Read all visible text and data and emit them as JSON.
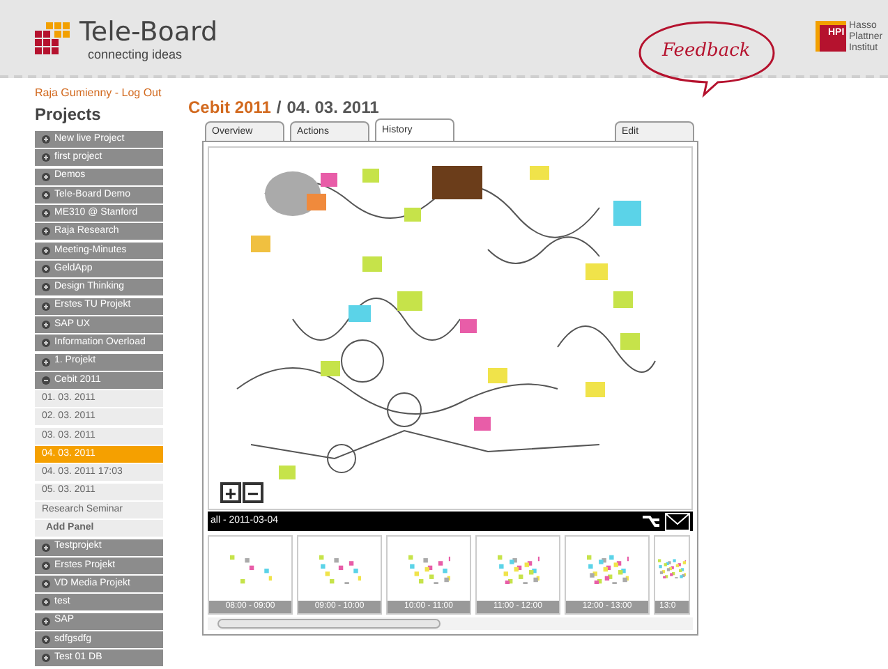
{
  "header": {
    "logo_title": "Tele-Board",
    "logo_tagline": "connecting ideas",
    "feedback": "Feedback",
    "institute_badge": "HPI",
    "institute_name": [
      "Hasso",
      "Plattner",
      "Institut"
    ]
  },
  "user_link": "Raja Gumienny - Log Out",
  "sidebar": {
    "title": "Projects",
    "items": [
      {
        "label": "New live Project",
        "expanded": false
      },
      {
        "label": "first project",
        "expanded": false
      },
      {
        "label": "Demos",
        "expanded": false
      },
      {
        "label": "Tele-Board Demo",
        "expanded": false
      },
      {
        "label": "ME310 @ Stanford",
        "expanded": false
      },
      {
        "label": "Raja Research",
        "expanded": false
      },
      {
        "label": "Meeting-Minutes",
        "expanded": false
      },
      {
        "label": "GeldApp",
        "expanded": false
      },
      {
        "label": "Design Thinking",
        "expanded": false
      },
      {
        "label": "Erstes TU Projekt",
        "expanded": false
      },
      {
        "label": "SAP UX",
        "expanded": false
      },
      {
        "label": "Information Overload",
        "expanded": false
      },
      {
        "label": "1. Projekt",
        "expanded": false
      },
      {
        "label": "Cebit 2011",
        "expanded": true,
        "children": [
          {
            "label": "01. 03. 2011",
            "kind": "panel",
            "selected": false
          },
          {
            "label": "02. 03. 2011",
            "kind": "panel",
            "selected": false
          },
          {
            "label": "03. 03. 2011",
            "kind": "panel",
            "selected": false
          },
          {
            "label": "04. 03. 2011",
            "kind": "panel",
            "selected": true
          },
          {
            "label": "04. 03. 2011 17:03",
            "kind": "panel",
            "selected": false
          },
          {
            "label": "05. 03. 2011",
            "kind": "panel",
            "selected": false
          },
          {
            "label": "Research Seminar",
            "kind": "panel",
            "selected": false
          },
          {
            "label": "Add Panel",
            "kind": "action",
            "selected": false
          }
        ]
      },
      {
        "label": "Testprojekt",
        "expanded": false
      },
      {
        "label": "Erstes Projekt",
        "expanded": false
      },
      {
        "label": "VD Media Projekt",
        "expanded": false
      },
      {
        "label": "test",
        "expanded": false
      },
      {
        "label": "SAP",
        "expanded": false
      },
      {
        "label": "sdfgsdfg",
        "expanded": false
      },
      {
        "label": "Test 01 DB",
        "expanded": false
      }
    ]
  },
  "breadcrumb": {
    "project": "Cebit 2011",
    "separator": "/",
    "panel": "04. 03. 2011"
  },
  "tabs": [
    {
      "label": "Overview",
      "selected": false
    },
    {
      "label": "Actions",
      "selected": false
    },
    {
      "label": "History",
      "selected": true
    },
    {
      "label": "Edit",
      "selected": false
    }
  ],
  "zoom_controls": [
    "+",
    "−"
  ],
  "timeline": {
    "label": "all - 2011-03-04",
    "snapshots": [
      {
        "caption": "08:00 - 09:00"
      },
      {
        "caption": "09:00 - 10:00"
      },
      {
        "caption": "10:00 - 11:00"
      },
      {
        "caption": "11:00 - 12:00"
      },
      {
        "caption": "12:00 - 13:00"
      },
      {
        "caption": "13:0"
      }
    ]
  }
}
